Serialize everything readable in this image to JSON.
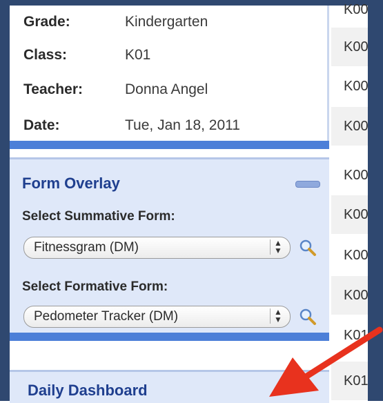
{
  "info": {
    "grade_label": "Grade:",
    "grade_value": "Kindergarten",
    "class_label": "Class:",
    "class_value": "K01",
    "teacher_label": "Teacher:",
    "teacher_value": "Donna Angel",
    "date_label": "Date:",
    "date_value": "Tue, Jan 18, 2011"
  },
  "form_overlay": {
    "title": "Form Overlay",
    "summative_label": "Select Summative Form:",
    "summative_value": "Fitnessgram (DM)",
    "formative_label": "Select Formative Form:",
    "formative_value": "Pedometer Tracker (DM)"
  },
  "daily_dashboard": {
    "title": "Daily Dashboard"
  },
  "right_column": {
    "items": [
      "K00",
      "K00",
      "K00",
      "K00",
      "K00",
      "K00",
      "K00",
      "K00",
      "K01",
      "K01"
    ]
  },
  "colors": {
    "accent": "#4c7fd8",
    "panel": "#dfe8f9",
    "title": "#1f3f8f",
    "annotation_arrow": "#e8321e"
  }
}
